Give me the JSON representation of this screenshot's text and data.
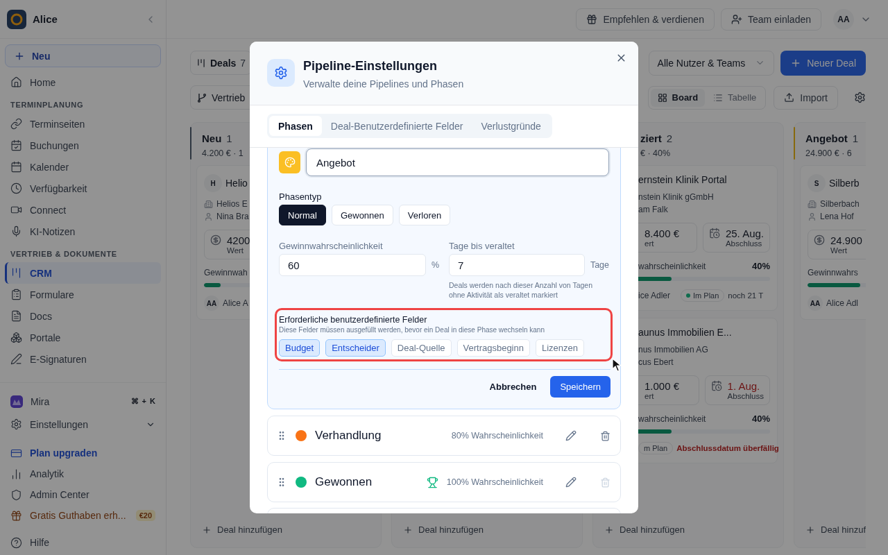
{
  "sidebar": {
    "workspace": "Alice",
    "new_button": "Neu",
    "items": [
      {
        "kind": "item",
        "label": "Home",
        "selected": false
      },
      {
        "kind": "section",
        "label": "TERMINPLANUNG"
      },
      {
        "kind": "item",
        "label": "Terminseiten",
        "selected": false
      },
      {
        "kind": "item",
        "label": "Buchungen",
        "selected": false
      },
      {
        "kind": "item",
        "label": "Kalender",
        "selected": false
      },
      {
        "kind": "item",
        "label": "Verfügbarkeit",
        "selected": false
      },
      {
        "kind": "item",
        "label": "Connect",
        "selected": false
      },
      {
        "kind": "item",
        "label": "KI-Notizen",
        "selected": false
      },
      {
        "kind": "section",
        "label": "VERTRIEB & DOKUMENTE"
      },
      {
        "kind": "item",
        "label": "CRM",
        "selected": true
      },
      {
        "kind": "item",
        "label": "Formulare",
        "selected": false
      },
      {
        "kind": "item",
        "label": "Docs",
        "selected": false
      },
      {
        "kind": "item",
        "label": "Portale",
        "selected": false
      },
      {
        "kind": "item",
        "label": "E-Signaturen",
        "selected": false
      }
    ],
    "bottom_items": [
      {
        "kind": "mira",
        "label": "Mira",
        "shortcut": [
          "⌘",
          "+",
          "K"
        ]
      },
      {
        "kind": "expand",
        "label": "Einstellungen"
      },
      {
        "kind": "upgrade",
        "label": "Plan upgraden"
      },
      {
        "kind": "item",
        "label": "Analytik"
      },
      {
        "kind": "item",
        "label": "Admin Center"
      },
      {
        "kind": "promo",
        "label": "Gratis Guthaben erh...",
        "badge": "€20"
      },
      {
        "kind": "help",
        "label": "Hilfe"
      }
    ]
  },
  "topbar": {
    "buttons": [
      "Empfehlen & verdienen",
      "Team einladen"
    ],
    "avatar": "AA"
  },
  "toolbar": {
    "deals_tab": "Deals",
    "deals_count": "7",
    "pipeline": "Vertrieb",
    "owner_filter": "Alle Nutzer & Teams",
    "new_deal": "Neuer Deal",
    "views": [
      {
        "label": "Board",
        "selected": true
      },
      {
        "label": "Tabelle",
        "selected": false
      }
    ],
    "import": "Import"
  },
  "board": [
    {
      "kind": "full",
      "title": "Neu",
      "count": "1",
      "summary": "4.200 € · 1",
      "color": "#2e3641",
      "add": "Deal hinzufügen",
      "cards": [
        {
          "avatar": "H",
          "title": "Helio",
          "company": "Helios E",
          "contact": "Nina Bra",
          "value": "4200",
          "value_label": "Wert",
          "probability_label": "Gewinnwah",
          "level": 0.1,
          "owner_initials": "AA",
          "owner": "Alice A"
        }
      ]
    },
    {
      "kind": "hidden",
      "add": "Deal hinzufügen"
    },
    {
      "kind": "cut",
      "title": "ziert",
      "count": "2",
      "summary": "€ · 40%",
      "add": "Deal hinzufügen",
      "cards": [
        {
          "title": "ernstein Klinik Portal",
          "company": "nstein Klinik gGmbH",
          "contact": "am Falk",
          "value": "8.400 €",
          "value_label": "ert",
          "date": "25. Aug.",
          "date_label": "Abschluss",
          "overdue": false,
          "probability_label": "wahrscheinlichkeit",
          "probability": "40%",
          "level": 0.4,
          "owner": "ice Adler",
          "status": "Im Plan",
          "status_dot": true,
          "due": "noch 21 T"
        },
        {
          "title": "aunus Immobilien E...",
          "company": "nus Immobilien AG",
          "contact": "cus Ebert",
          "value": "1.000 €",
          "value_label": "ert",
          "date": "1. Aug.",
          "date_label": "Abschluss",
          "overdue": true,
          "probability_label": "wahrscheinlichkeit",
          "probability": "40%",
          "level": 0.4,
          "status": "m Plan",
          "status_dot": false,
          "warning": "Abschlussdatum überfällig"
        }
      ]
    },
    {
      "kind": "full",
      "title": "Angebot",
      "count": "1",
      "summary": "24.900 € · 6",
      "color": "#87690c",
      "add": "Deal hinzuf",
      "cards": [
        {
          "avatar": "S",
          "title": "Silberb",
          "company": "Silberbach",
          "contact": "Lena Hof",
          "value": "24.900",
          "value_label": "Wert",
          "probability_label": "Gewinnwahrs",
          "level": 0.32,
          "owner_initials": "AA",
          "owner": "Alice Adl"
        }
      ]
    }
  ],
  "modal": {
    "title": "Pipeline-Einstellungen",
    "subtitle": "Verwalte deine Pipelines und Phasen",
    "tabs": [
      {
        "label": "Phasen",
        "selected": true
      },
      {
        "label": "Deal-Benutzerdefinierte Felder",
        "selected": false
      },
      {
        "label": "Verlustgründe",
        "selected": false
      }
    ],
    "editor": {
      "name": "Angebot",
      "color": "#fbbf24",
      "type_label": "Phasentyp",
      "types": [
        {
          "label": "Normal",
          "selected": true
        },
        {
          "label": "Gewonnen",
          "selected": false
        },
        {
          "label": "Verloren",
          "selected": false
        }
      ],
      "probability": {
        "label": "Gewinnwahrscheinlichkeit",
        "value": "60",
        "unit": "%"
      },
      "stale": {
        "label": "Tage bis veraltet",
        "value": "7",
        "unit": "Tage",
        "hint": "Deals werden nach dieser Anzahl von Tagen ohne Aktivität als veraltet markiert"
      },
      "required_fields": {
        "title": "Erforderliche benutzerdefinierte Felder",
        "subtitle": "Diese Felder müssen ausgefüllt werden, bevor ein Deal in diese Phase wechseln kann",
        "highlighted": true,
        "fields": [
          {
            "label": "Budget",
            "selected": true
          },
          {
            "label": "Entscheider",
            "selected": true
          },
          {
            "label": "Deal-Quelle",
            "selected": false
          },
          {
            "label": "Vertragsbeginn",
            "selected": false
          },
          {
            "label": "Lizenzen",
            "selected": false
          }
        ]
      },
      "cancel": "Abbrechen",
      "save": "Speichern"
    },
    "phases": [
      {
        "name": "Verhandlung",
        "color": "#f97316",
        "probability": "80% Wahrscheinlichkeit",
        "won": false,
        "deletable": true
      },
      {
        "name": "Gewonnen",
        "color": "#10b981",
        "probability": "100% Wahrscheinlichkeit",
        "won": true,
        "deletable": false
      }
    ]
  }
}
